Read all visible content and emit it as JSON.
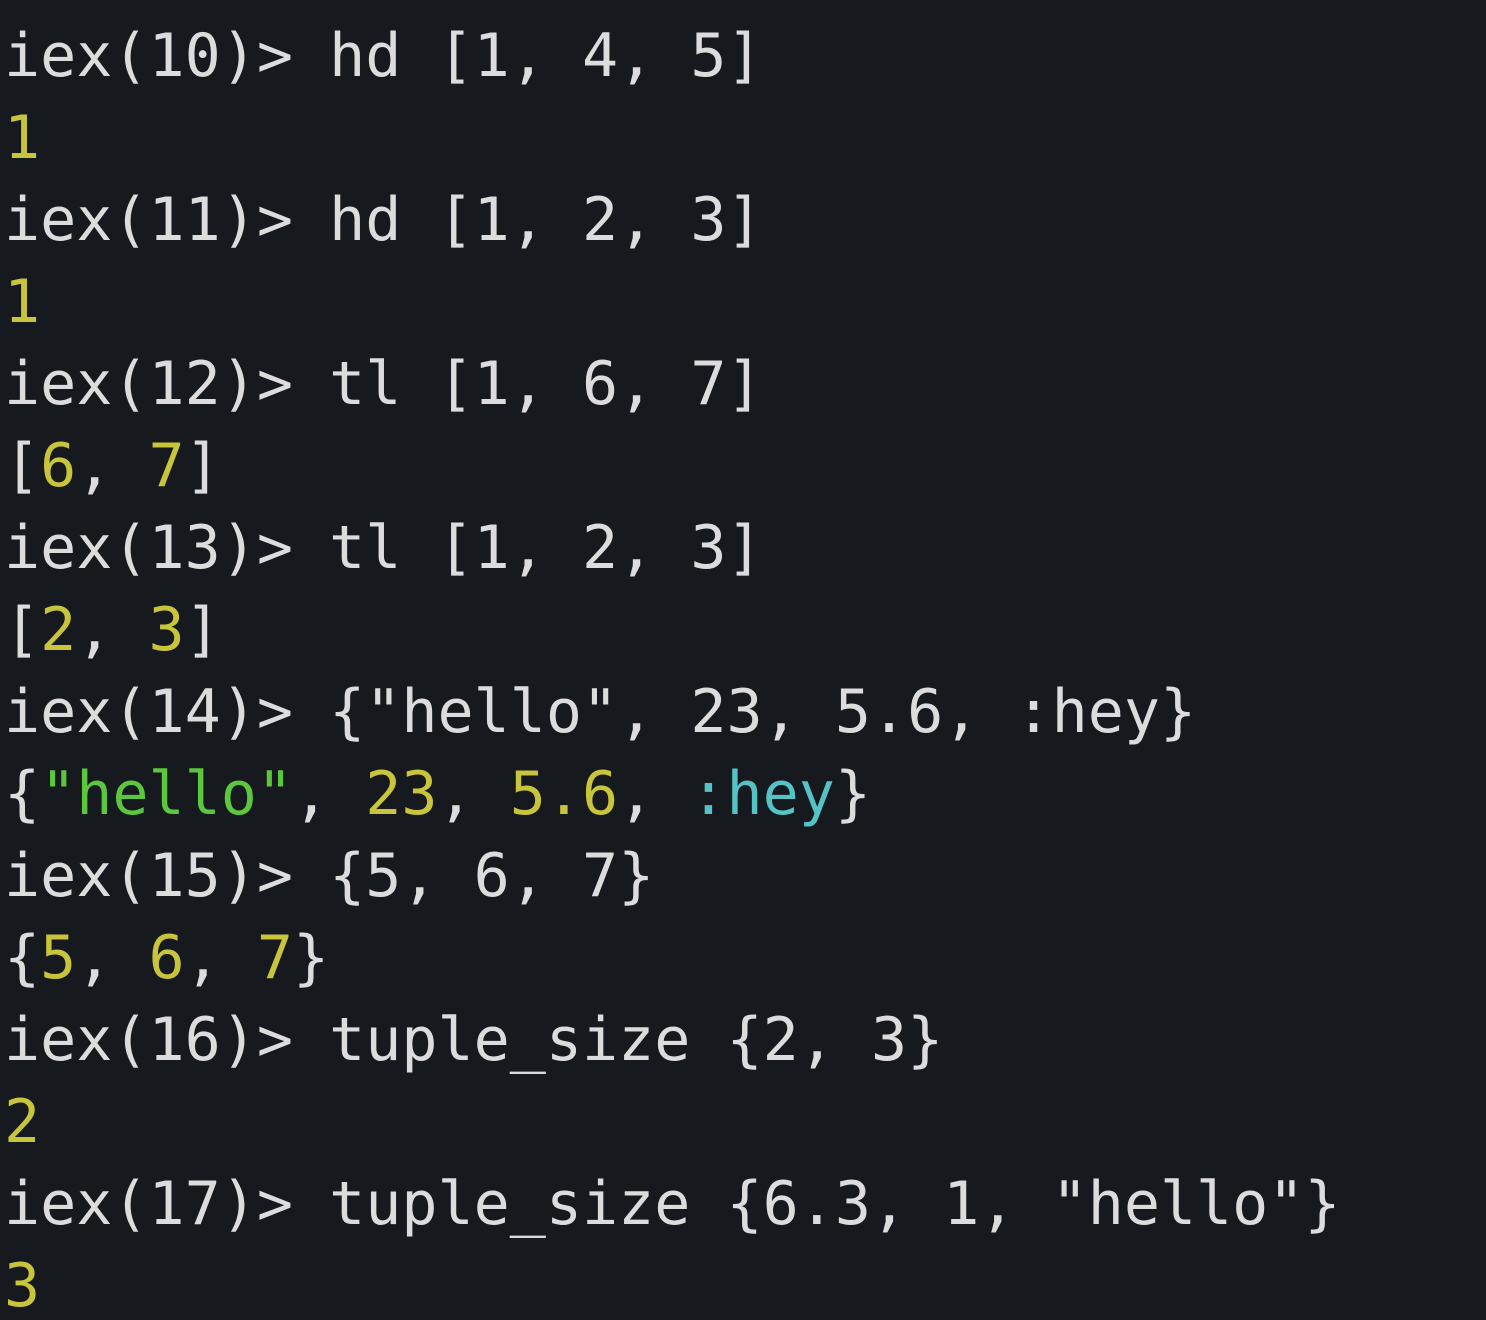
{
  "theme": {
    "background": "#16191e",
    "text": "#dcdcdc",
    "number": "#c8c43c",
    "string": "#5cc63e",
    "atom": "#55c3c6"
  },
  "lines": [
    [
      {
        "t": "iex(10)> hd [1, 4, 5]",
        "k": "text"
      }
    ],
    [
      {
        "t": "1",
        "k": "num"
      }
    ],
    [
      {
        "t": "iex(11)> hd [1, 2, 3]",
        "k": "text"
      }
    ],
    [
      {
        "t": "1",
        "k": "num"
      }
    ],
    [
      {
        "t": "iex(12)> tl [1, 6, 7]",
        "k": "text"
      }
    ],
    [
      {
        "t": "[",
        "k": "text"
      },
      {
        "t": "6",
        "k": "num"
      },
      {
        "t": ", ",
        "k": "text"
      },
      {
        "t": "7",
        "k": "num"
      },
      {
        "t": "]",
        "k": "text"
      }
    ],
    [
      {
        "t": "iex(13)> tl [1, 2, 3]",
        "k": "text"
      }
    ],
    [
      {
        "t": "[",
        "k": "text"
      },
      {
        "t": "2",
        "k": "num"
      },
      {
        "t": ", ",
        "k": "text"
      },
      {
        "t": "3",
        "k": "num"
      },
      {
        "t": "]",
        "k": "text"
      }
    ],
    [
      {
        "t": "iex(14)> {\"hello\", 23, 5.6, :hey}",
        "k": "text"
      }
    ],
    [
      {
        "t": "{",
        "k": "text"
      },
      {
        "t": "\"hello\"",
        "k": "str"
      },
      {
        "t": ", ",
        "k": "text"
      },
      {
        "t": "23",
        "k": "num"
      },
      {
        "t": ", ",
        "k": "text"
      },
      {
        "t": "5.6",
        "k": "num"
      },
      {
        "t": ", ",
        "k": "text"
      },
      {
        "t": ":hey",
        "k": "atom"
      },
      {
        "t": "}",
        "k": "text"
      }
    ],
    [
      {
        "t": "iex(15)> {5, 6, 7}",
        "k": "text"
      }
    ],
    [
      {
        "t": "{",
        "k": "text"
      },
      {
        "t": "5",
        "k": "num"
      },
      {
        "t": ", ",
        "k": "text"
      },
      {
        "t": "6",
        "k": "num"
      },
      {
        "t": ", ",
        "k": "text"
      },
      {
        "t": "7",
        "k": "num"
      },
      {
        "t": "}",
        "k": "text"
      }
    ],
    [
      {
        "t": "iex(16)> tuple_size {2, 3}",
        "k": "text"
      }
    ],
    [
      {
        "t": "2",
        "k": "num"
      }
    ],
    [
      {
        "t": "iex(17)> tuple_size {6.3, 1, \"hello\"}",
        "k": "text"
      }
    ],
    [
      {
        "t": "3",
        "k": "num"
      }
    ]
  ]
}
